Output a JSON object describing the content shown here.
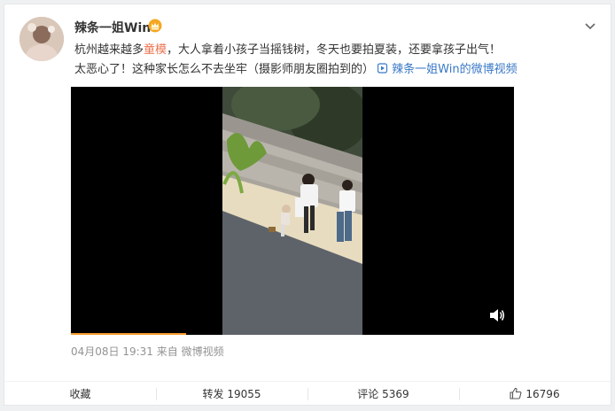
{
  "post": {
    "username": "辣条一姐Win",
    "text_line1_a": "杭州越来越多",
    "text_line1_highlight": "童模",
    "text_line1_b": "，大人拿着小孩子当摇钱树，冬天也要拍夏装，还要拿孩子出气！",
    "text_line2": "太恶心了！这种家长怎么不去坐牢（摄影师朋友圈拍到的）",
    "video_link": "辣条一姐Win的微博视频",
    "timestamp": "04月08日 19:31 来自 微博视频"
  },
  "video": {
    "progress_fraction": 0.26
  },
  "actions": {
    "favorite": "收藏",
    "repost_label": "转发",
    "repost_count": "19055",
    "comment_label": "评论",
    "comment_count": "5369",
    "like_count": "16796"
  },
  "colors": {
    "highlight": "#eb7350",
    "link": "#3978c7",
    "progress": "#f79a2a"
  },
  "icons": [
    "crown-icon",
    "chevron-down-icon",
    "video-link-icon",
    "volume-icon",
    "like-thumb-icon"
  ]
}
